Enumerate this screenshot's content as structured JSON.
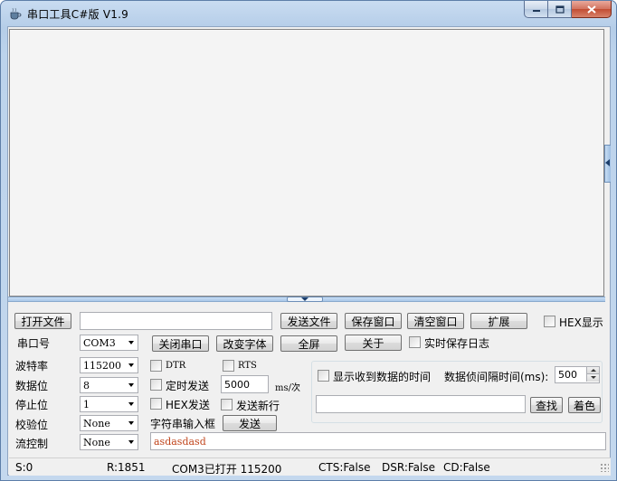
{
  "window": {
    "title": "串口工具C#版  V1.9",
    "icon": "coffee-cup-icon",
    "min_icon": "minimize-icon",
    "max_icon": "maximize-icon",
    "close_icon": "close-icon"
  },
  "toolbar1": {
    "open_file": "打开文件",
    "file_path": "",
    "send_file": "发送文件",
    "save_window": "保存窗口",
    "clear_window": "清空窗口",
    "expand": "扩展",
    "hex_display": "HEX显示"
  },
  "toolbar2": {
    "port_label": "串口号",
    "port_value": "COM3",
    "close_port": "关闭串口",
    "change_font": "改变字体",
    "fullscreen": "全屏",
    "about": "关于",
    "realtime_log": "实时保存日志"
  },
  "settings": {
    "baud_label": "波特率",
    "baud_value": "115200",
    "databits_label": "数据位",
    "databits_value": "8",
    "stopbits_label": "停止位",
    "stopbits_value": "1",
    "parity_label": "校验位",
    "parity_value": "None",
    "flow_label": "流控制",
    "flow_value": "None"
  },
  "send": {
    "dtr": "DTR",
    "rts": "RTS",
    "timed_send": "定时发送",
    "interval_value": "5000",
    "interval_unit": "ms/次",
    "hex_send": "HEX发送",
    "send_newline": "发送新行",
    "string_input_label": "字符串输入框",
    "send_button": "发送",
    "input_value": "asdasdasd"
  },
  "receive_opts": {
    "show_time": "显示收到数据的时间",
    "frame_interval_label": "数据侦间隔时间(ms):",
    "frame_interval_value": "500",
    "search_value": "",
    "find": "查找",
    "color": "着色"
  },
  "status": {
    "sent": "S:0",
    "received": "R:1851",
    "port_state": "COM3已打开  115200",
    "cts": "CTS:False",
    "dsr": "DSR:False",
    "cd": "CD:False"
  }
}
